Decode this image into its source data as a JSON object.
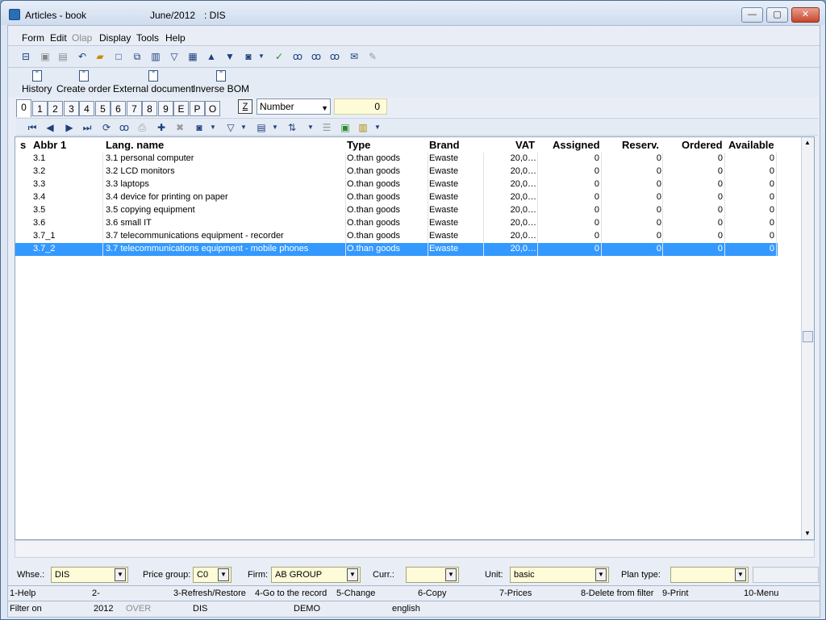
{
  "window": {
    "title": "Articles - book",
    "period": "June/2012",
    "company": ": DIS"
  },
  "menu": [
    "Form",
    "Edit",
    "Olap",
    "Display",
    "Tools",
    "Help"
  ],
  "actions": [
    "History",
    "Create order",
    "External document",
    "Inverse BOM"
  ],
  "tabs": [
    "0",
    "1",
    "2",
    "3",
    "4",
    "5",
    "6",
    "7",
    "8",
    "9",
    "E",
    "P",
    "O"
  ],
  "sort": {
    "z_label": "Z",
    "field": "Number",
    "value": "0"
  },
  "grid": {
    "columns": [
      "s",
      "Abbr 1",
      "Lang. name",
      "Type",
      "Brand",
      "VAT",
      "Assigned",
      "Reserv.",
      "Ordered",
      "Available"
    ],
    "rows": [
      [
        "",
        "3.1",
        "3.1 personal computer",
        "O.than goods",
        "Ewaste",
        "20,0…",
        "0",
        "0",
        "0",
        "0"
      ],
      [
        "",
        "3.2",
        "3.2 LCD monitors",
        "O.than goods",
        "Ewaste",
        "20,0…",
        "0",
        "0",
        "0",
        "0"
      ],
      [
        "",
        "3.3",
        "3.3 laptops",
        "O.than goods",
        "Ewaste",
        "20,0…",
        "0",
        "0",
        "0",
        "0"
      ],
      [
        "",
        "3.4",
        "3.4 device for printing on paper",
        "O.than goods",
        "Ewaste",
        "20,0…",
        "0",
        "0",
        "0",
        "0"
      ],
      [
        "",
        "3.5",
        "3.5 copying equipment",
        "O.than goods",
        "Ewaste",
        "20,0…",
        "0",
        "0",
        "0",
        "0"
      ],
      [
        "",
        "3.6",
        "3.6 small IT",
        "O.than goods",
        "Ewaste",
        "20,0…",
        "0",
        "0",
        "0",
        "0"
      ],
      [
        "",
        "3.7_1",
        "3.7 telecommunications equipment - recorder",
        "O.than goods",
        "Ewaste",
        "20,0…",
        "0",
        "0",
        "0",
        "0"
      ],
      [
        "",
        "3.7_2",
        "3.7  telecommunications equipment - mobile phones",
        "O.than goods",
        "Ewaste",
        "20,0…",
        "0",
        "0",
        "0",
        "0"
      ]
    ],
    "selected_row": 7
  },
  "filters": {
    "whse_label": "Whse.:",
    "whse": "DIS",
    "price_group_label": "Price group:",
    "price_group": "C0",
    "firm_label": "Firm:",
    "firm": "AB GROUP",
    "curr_label": "Curr.:",
    "curr": "",
    "unit_label": "Unit:",
    "unit": "basic",
    "plan_type_label": "Plan type:",
    "plan_type": ""
  },
  "fkeys": [
    "1-Help",
    "2-",
    "3-Refresh/Restore",
    "4-Go to the record",
    "5-Change",
    "6-Copy",
    "7-Prices",
    "8-Delete from filter",
    "9-Print",
    "10-Menu"
  ],
  "status": {
    "filter": "Filter on",
    "year": "2012",
    "mode": "OVER",
    "company": "DIS",
    "db": "DEMO",
    "lang": "english"
  }
}
